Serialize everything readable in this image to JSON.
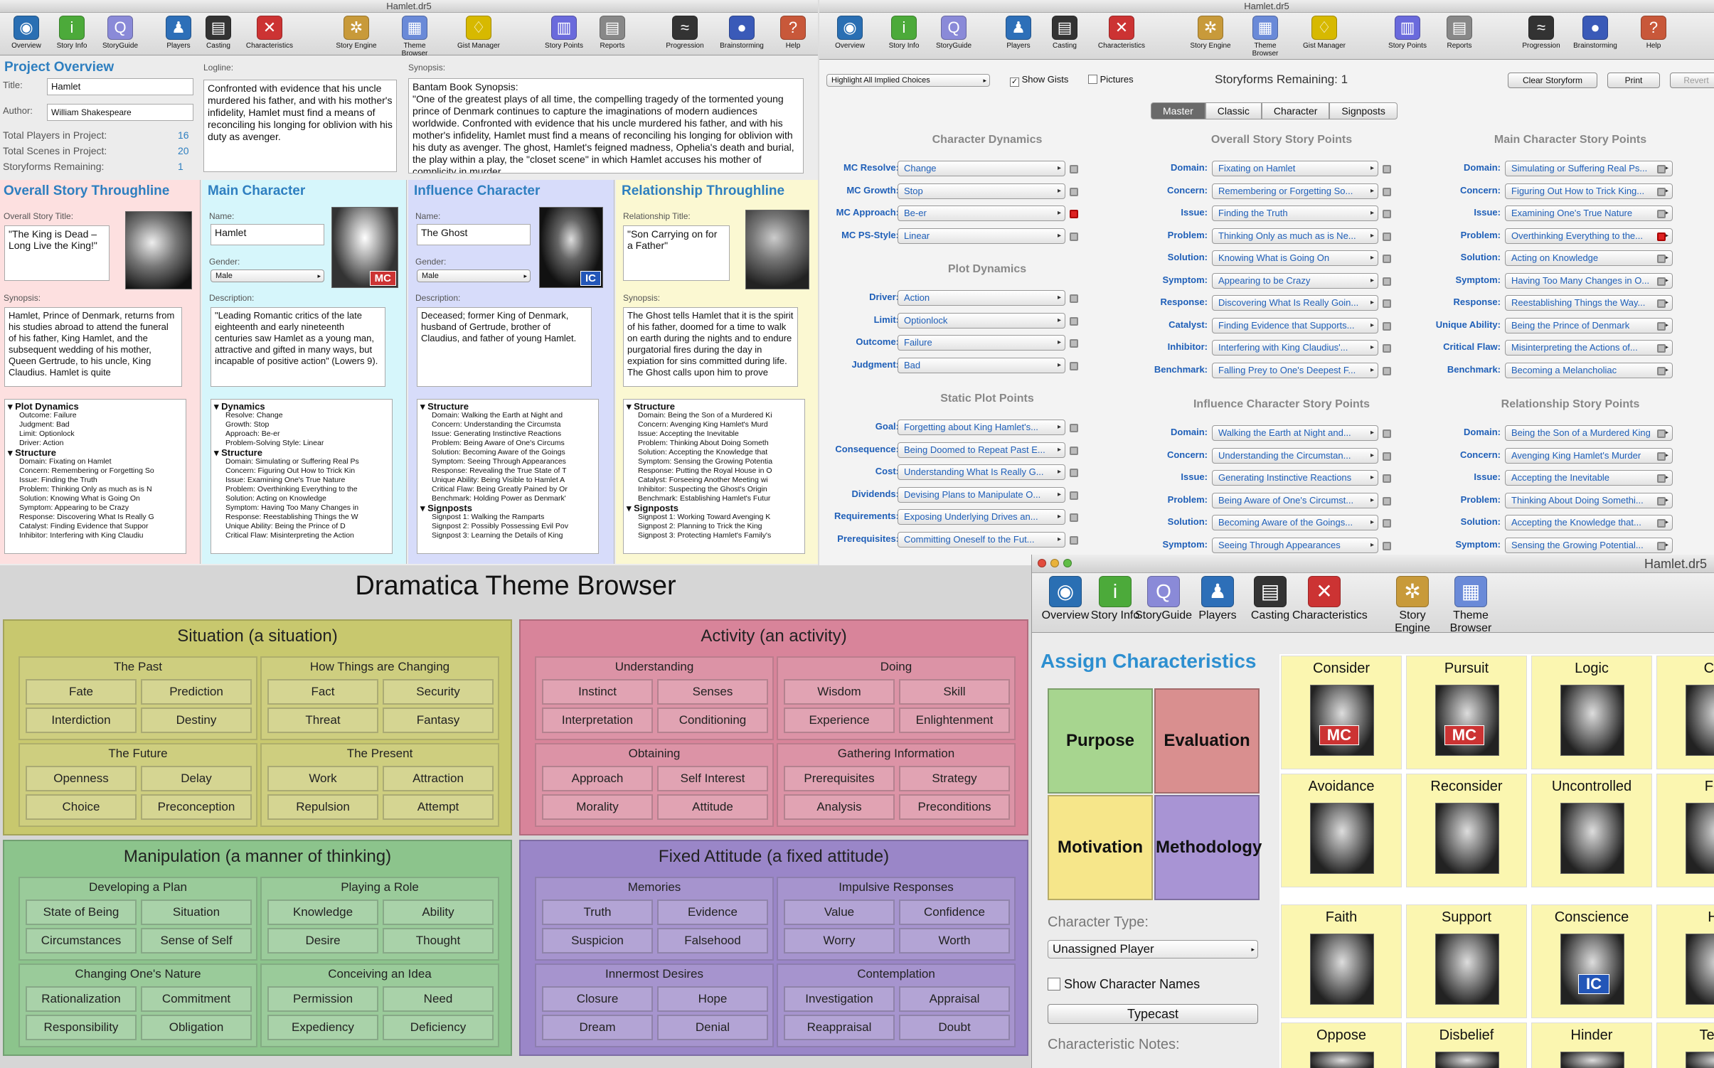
{
  "w1": {
    "title": "Hamlet.dr5",
    "toolbar": [
      "Overview",
      "Story Info",
      "StoryGuide",
      "Players",
      "Casting",
      "Characteristics",
      "Story Engine",
      "Theme Browser",
      "Gist Manager",
      "Story Points",
      "Reports",
      "Progression",
      "Brainstorming",
      "Help"
    ],
    "overview": {
      "heading": "Project Overview",
      "title_label": "Title:",
      "title_value": "Hamlet",
      "author_label": "Author:",
      "author_value": "William Shakespeare",
      "stats": [
        {
          "label": "Total Players in Project:",
          "value": "16"
        },
        {
          "label": "Total Scenes in Project:",
          "value": "20"
        },
        {
          "label": "Storyforms Remaining:",
          "value": "1"
        }
      ]
    },
    "logline": {
      "label": "Logline:",
      "text": "Confronted with evidence that his uncle murdered his father, and with his mother's infidelity, Hamlet must find a means of reconciling his longing for oblivion with his duty as avenger."
    },
    "synopsis": {
      "label": "Synopsis:",
      "text": "Bantam Book Synopsis:\n\"One of the greatest plays of all time, the compelling tragedy of the tormented young prince of Denmark continues to capture the imaginations of modern audiences worldwide. Confronted with evidence that his uncle murdered his father, and with his mother's infidelity, Hamlet must find a means of reconciling his longing for oblivion with his duty as avenger. The ghost, Hamlet's feigned madness, Ophelia's death and burial, the play within a play, the \"closet scene\" in which Hamlet accuses his mother of complicity in murder"
    },
    "os": {
      "heading": "Overall Story Throughline",
      "title_label": "Overall Story Title:",
      "title": "\"The King is Dead – Long Live the King!\"",
      "syn_label": "Synopsis:",
      "syn": "Hamlet, Prince of Denmark, returns from his studies abroad to attend the funeral of his father, King Hamlet, and the subsequent wedding of his mother, Queen Gertrude, to his uncle, King Claudius. Hamlet is quite",
      "outline": [
        {
          "h": "Plot Dynamics",
          "items": [
            "Outcome:  Failure",
            "Judgment:  Bad",
            "Limit:  Optionlock",
            "Driver:  Action"
          ]
        },
        {
          "h": "Structure",
          "items": [
            "Domain:  Fixating on Hamlet",
            "Concern:  Remembering or Forgetting So",
            "Issue:  Finding the Truth",
            "Problem:  Thinking Only as much as is N",
            "Solution:  Knowing What is Going On",
            "Symptom:  Appearing to be Crazy",
            "Response:  Discovering What Is Really G",
            "Catalyst:  Finding Evidence that Suppor",
            "Inhibitor:  Interfering with King Claudiu"
          ]
        }
      ]
    },
    "mc": {
      "heading": "Main Character",
      "name_label": "Name:",
      "name": "Hamlet",
      "gender_label": "Gender:",
      "gender": "Male",
      "badge": "MC",
      "desc_label": "Description:",
      "desc": "\"Leading Romantic critics of the late eighteenth and early nineteenth centuries saw Hamlet as a young man, attractive and gifted in many ways, but incapable of positive action\" (Lowers 9).",
      "outline": [
        {
          "h": "Dynamics",
          "items": [
            "Resolve:  Change",
            "Growth:  Stop",
            "Approach:  Be-er",
            "Problem-Solving Style:  Linear"
          ]
        },
        {
          "h": "Structure",
          "items": [
            "Domain:  Simulating or Suffering Real Ps",
            "Concern:  Figuring Out How to Trick Kin",
            "Issue:  Examining One's True Nature",
            "Problem:  Overthinking Everything to the",
            "Solution:  Acting on Knowledge",
            "Symptom:  Having Too Many Changes in",
            "Response:  Reestablishing Things the W",
            "Unique Ability:  Being the Prince of D",
            "Critical Flaw:  Misinterpreting the Action"
          ]
        }
      ]
    },
    "ic": {
      "heading": "Influence Character",
      "name_label": "Name:",
      "name": "The Ghost",
      "gender_label": "Gender:",
      "gender": "Male",
      "badge": "IC",
      "desc_label": "Description:",
      "desc": "Deceased; former King of Denmark, husband of Gertrude, brother of Claudius, and father of young Hamlet.",
      "outline": [
        {
          "h": "Structure",
          "items": [
            "Domain:  Walking the Earth at Night and",
            "Concern:  Understanding the Circumsta",
            "Issue:  Generating Instinctive Reactions",
            "Problem:  Being Aware of One's Circums",
            "Solution:  Becoming Aware of the Goings",
            "Symptom:  Seeing Through Appearances",
            "Response:  Revealing the True State of T",
            "Unique Ability:  Being Visible to Hamlet A",
            "Critical Flaw:  Being Greatly Pained by Or",
            "Benchmark:  Holding Power as Denmark'"
          ]
        },
        {
          "h": "Signposts",
          "items": [
            "Signpost 1:  Walking the Ramparts",
            "Signpost 2:  Possibly Possessing Evil Pov",
            "Signpost 3:  Learning the Details of King"
          ]
        }
      ]
    },
    "rs": {
      "heading": "Relationship Throughline",
      "title_label": "Relationship Title:",
      "title": "\"Son Carrying on for a Father\"",
      "syn_label": "Synopsis:",
      "syn": "The Ghost tells Hamlet that it is the spirit of his father, doomed for a time to walk on earth during the nights and to endure purgatorial fires during the day in expiation for sins committed during life. The Ghost calls upon him to prove",
      "outline": [
        {
          "h": "Structure",
          "items": [
            "Domain:  Being the Son of a Murdered Ki",
            "Concern:  Avenging King Hamlet's Murd",
            "Issue:  Accepting the Inevitable",
            "Problem:  Thinking About Doing Someth",
            "Solution:  Accepting the Knowledge that",
            "Symptom:  Sensing the Growing Potentia",
            "Response:  Putting the Royal House in O",
            "Catalyst:  Forseeing Another Meeting wi",
            "Inhibitor:  Suspecting the Ghost's Origin",
            "Benchmark:  Establishing Hamlet's Futur"
          ]
        },
        {
          "h": "Signposts",
          "items": [
            "Signpost 1:  Working Toward Avenging K",
            "Signpost 2:  Planning to Trick the King",
            "Signpost 3:  Protecting Hamlet's Family's"
          ]
        }
      ]
    }
  },
  "w2": {
    "title": "Hamlet.dr5",
    "toolbar": [
      "Overview",
      "Story Info",
      "StoryGuide",
      "Players",
      "Casting",
      "Characteristics",
      "Story Engine",
      "Theme Browser",
      "Gist Manager",
      "Story Points",
      "Reports",
      "Progression",
      "Brainstorming",
      "Help"
    ],
    "highlight": "Highlight All Implied Choices",
    "show_gists": "Show Gists",
    "pictures": "Pictures",
    "remaining": "Storyforms Remaining: 1",
    "clear": "Clear Storyform",
    "print": "Print",
    "revert": "Revert",
    "tabs": [
      "Master",
      "Classic",
      "Character",
      "Signposts"
    ],
    "char_dyn": {
      "h": "Character Dynamics",
      "rows": [
        [
          "MC Resolve:",
          "Change"
        ],
        [
          "MC Growth:",
          "Stop"
        ],
        [
          "MC Approach:",
          "Be-er"
        ],
        [
          "MC PS-Style:",
          "Linear"
        ]
      ]
    },
    "plot_dyn": {
      "h": "Plot Dynamics",
      "rows": [
        [
          "Driver:",
          "Action"
        ],
        [
          "Limit:",
          "Optionlock"
        ],
        [
          "Outcome:",
          "Failure"
        ],
        [
          "Judgment:",
          "Bad"
        ]
      ]
    },
    "static": {
      "h": "Static Plot Points",
      "rows": [
        [
          "Goal:",
          "Forgetting about King Hamlet's..."
        ],
        [
          "Consequence:",
          "Being Doomed to Repeat Past E..."
        ],
        [
          "Cost:",
          "Understanding What Is Really G..."
        ],
        [
          "Dividends:",
          "Devising Plans to Manipulate O..."
        ],
        [
          "Requirements:",
          "Exposing Underlying Drives an..."
        ],
        [
          "Prerequisites:",
          "Committing Oneself to the Fut..."
        ]
      ]
    },
    "os_sp": {
      "h": "Overall Story Story Points",
      "rows": [
        [
          "Domain:",
          "Fixating on Hamlet"
        ],
        [
          "Concern:",
          "Remembering or Forgetting So..."
        ],
        [
          "Issue:",
          "Finding the Truth"
        ],
        [
          "Problem:",
          "Thinking Only as much as is Ne..."
        ],
        [
          "Solution:",
          "Knowing What is Going On"
        ],
        [
          "Symptom:",
          "Appearing to be Crazy"
        ],
        [
          "Response:",
          "Discovering What Is Really Goin..."
        ],
        [
          "Catalyst:",
          "Finding Evidence that Supports..."
        ],
        [
          "Inhibitor:",
          "Interfering with King Claudius'..."
        ],
        [
          "Benchmark:",
          "Falling Prey to One's Deepest F..."
        ]
      ]
    },
    "ic_sp": {
      "h": "Influence Character Story Points",
      "rows": [
        [
          "Domain:",
          "Walking the Earth at Night and..."
        ],
        [
          "Concern:",
          "Understanding the Circumstan..."
        ],
        [
          "Issue:",
          "Generating Instinctive Reactions"
        ],
        [
          "Problem:",
          "Being Aware of One's Circumst..."
        ],
        [
          "Solution:",
          "Becoming Aware of the Goings..."
        ],
        [
          "Symptom:",
          "Seeing Through Appearances"
        ]
      ]
    },
    "mc_sp": {
      "h": "Main Character Story Points",
      "rows": [
        [
          "Domain:",
          "Simulating or Suffering Real Ps..."
        ],
        [
          "Concern:",
          "Figuring Out How to Trick King..."
        ],
        [
          "Issue:",
          "Examining One's True Nature"
        ],
        [
          "Problem:",
          "Overthinking Everything to the..."
        ],
        [
          "Solution:",
          "Acting on Knowledge"
        ],
        [
          "Symptom:",
          "Having Too Many Changes in O..."
        ],
        [
          "Response:",
          "Reestablishing Things the Way..."
        ],
        [
          "Unique Ability:",
          "Being the Prince of Denmark"
        ],
        [
          "Critical Flaw:",
          "Misinterpreting the Actions of..."
        ],
        [
          "Benchmark:",
          "Becoming a Melancholiac"
        ]
      ]
    },
    "rs_sp": {
      "h": "Relationship Story Points",
      "rows": [
        [
          "Domain:",
          "Being the Son of a Murdered King"
        ],
        [
          "Concern:",
          "Avenging King Hamlet's Murder"
        ],
        [
          "Issue:",
          "Accepting the Inevitable"
        ],
        [
          "Problem:",
          "Thinking About Doing Somethi..."
        ],
        [
          "Solution:",
          "Accepting the Knowledge that..."
        ],
        [
          "Symptom:",
          "Sensing the Growing Potential..."
        ]
      ]
    }
  },
  "w3": {
    "title": "Dramatica Theme Browser",
    "quads": [
      {
        "name": "Situation (a situation)",
        "color": "#c8c86e",
        "groups": [
          {
            "n": "The Past",
            "c": [
              "Fate",
              "Prediction",
              "Interdiction",
              "Destiny"
            ]
          },
          {
            "n": "How Things are Changing",
            "c": [
              "Fact",
              "Security",
              "Threat",
              "Fantasy"
            ]
          },
          {
            "n": "The Future",
            "c": [
              "Openness",
              "Delay",
              "Choice",
              "Preconception"
            ]
          },
          {
            "n": "The Present",
            "c": [
              "Work",
              "Attraction",
              "Repulsion",
              "Attempt"
            ]
          }
        ]
      },
      {
        "name": "Activity (an activity)",
        "color": "#d8849a",
        "groups": [
          {
            "n": "Understanding",
            "c": [
              "Instinct",
              "Senses",
              "Interpretation",
              "Conditioning"
            ]
          },
          {
            "n": "Doing",
            "c": [
              "Wisdom",
              "Skill",
              "Experience",
              "Enlightenment"
            ]
          },
          {
            "n": "Obtaining",
            "c": [
              "Approach",
              "Self Interest",
              "Morality",
              "Attitude"
            ]
          },
          {
            "n": "Gathering Information",
            "c": [
              "Prerequisites",
              "Strategy",
              "Analysis",
              "Preconditions"
            ]
          }
        ]
      },
      {
        "name": "Manipulation (a manner of thinking)",
        "color": "#8cc48c",
        "groups": [
          {
            "n": "Developing a Plan",
            "c": [
              "State of Being",
              "Situation",
              "Circumstances",
              "Sense of Self"
            ]
          },
          {
            "n": "Playing a Role",
            "c": [
              "Knowledge",
              "Ability",
              "Desire",
              "Thought"
            ]
          },
          {
            "n": "Changing One's Nature",
            "c": [
              "Rationalization",
              "Commitment",
              "Responsibility",
              "Obligation"
            ]
          },
          {
            "n": "Conceiving an Idea",
            "c": [
              "Permission",
              "Need",
              "Expediency",
              "Deficiency"
            ]
          }
        ]
      },
      {
        "name": "Fixed Attitude (a fixed attitude)",
        "color": "#9a86c8",
        "groups": [
          {
            "n": "Memories",
            "c": [
              "Truth",
              "Evidence",
              "Suspicion",
              "Falsehood"
            ]
          },
          {
            "n": "Impulsive Responses",
            "c": [
              "Value",
              "Confidence",
              "Worry",
              "Worth"
            ]
          },
          {
            "n": "Innermost Desires",
            "c": [
              "Closure",
              "Hope",
              "Dream",
              "Denial"
            ]
          },
          {
            "n": "Contemplation",
            "c": [
              "Investigation",
              "Appraisal",
              "Reappraisal",
              "Doubt"
            ]
          }
        ]
      }
    ]
  },
  "w4": {
    "title": "Hamlet.dr5",
    "toolbar": [
      "Overview",
      "Story Info",
      "StoryGuide",
      "Players",
      "Casting",
      "Characteristics",
      "Story Engine",
      "Theme Browser"
    ],
    "heading": "Assign Characteristics",
    "quads": [
      "Purpose",
      "Evaluation",
      "Motivation",
      "Methodology"
    ],
    "type_label": "Character Type:",
    "type_value": "Unassigned Player",
    "show_names": "Show Character Names",
    "typecast": "Typecast",
    "notes_label": "Characteristic Notes:",
    "cards": [
      {
        "n": "Consider",
        "b": "MC"
      },
      {
        "n": "Pursuit",
        "b": "MC"
      },
      {
        "n": "Logic",
        "b": ""
      },
      {
        "n": "Con",
        "b": ""
      },
      {
        "n": "Avoidance",
        "b": ""
      },
      {
        "n": "Reconsider",
        "b": ""
      },
      {
        "n": "Uncontrolled",
        "b": ""
      },
      {
        "n": "Fee",
        "b": ""
      },
      {
        "n": "Faith",
        "b": ""
      },
      {
        "n": "Support",
        "b": ""
      },
      {
        "n": "Conscience",
        "b": "IC"
      },
      {
        "n": "He",
        "b": ""
      },
      {
        "n": "Oppose",
        "b": ""
      },
      {
        "n": "Disbelief",
        "b": ""
      },
      {
        "n": "Hinder",
        "b": ""
      },
      {
        "n": "Temp",
        "b": ""
      }
    ]
  }
}
